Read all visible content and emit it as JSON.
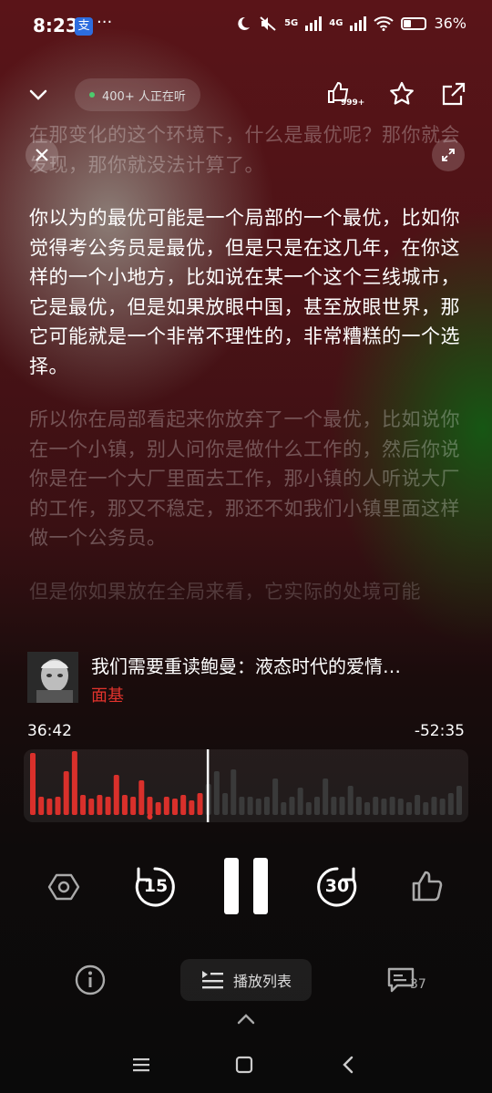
{
  "status_bar": {
    "time": "8:23",
    "app_icon_label": "支",
    "more": "···",
    "network_5g": "5G",
    "network_4g": "4G",
    "battery": "36%",
    "battery_level": 0.36
  },
  "header": {
    "listeners": "400+ 人正在听",
    "share_count_badge": "999+"
  },
  "transcript": [
    "在那变化的这个环境下，什么是最优呢？那你就会发现，那你就没法计算了。",
    "你以为的最优可能是一个局部的一个最优，比如你觉得考公务员是最优，但是只是在这几年，在你这样的一个小地方，比如说在某一个这个三线城市，它是最优，但是如果放眼中国，甚至放眼世界，那它可能就是一个非常不理性的，非常糟糕的一个选择。",
    "所以你在局部看起来你放弃了一个最优，比如说你在一个小镇，别人问你是做什么工作的，然后你说你是在一个大厂里面去工作，那小镇的人听说大厂的工作，那又不稳定，那还不如我们小镇里面这样做一个公务员。",
    "但是你如果放在全局来看，它实际的处境可能"
  ],
  "track": {
    "title": "我们需要重读鲍曼：液态时代的爱情…",
    "author": "面基"
  },
  "progress": {
    "elapsed": "36:42",
    "remaining": "-52:35",
    "played_fraction": 0.41
  },
  "controls": {
    "rewind_seconds": "15",
    "forward_seconds": "30"
  },
  "bottom": {
    "playlist_label": "播放列表",
    "comment_count": "37"
  },
  "colors": {
    "accent": "#e1332d",
    "progress_played": "#d9302b",
    "progress_unplayed": "#3a3a3a"
  }
}
